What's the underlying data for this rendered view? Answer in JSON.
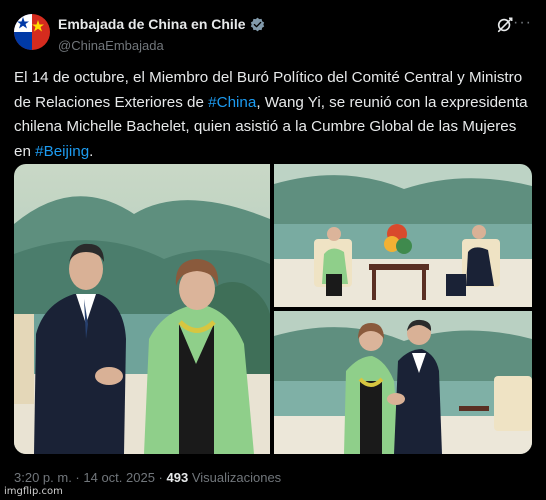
{
  "author": {
    "display_name": "Embajada de China en Chile",
    "handle": "@ChinaEmbajada"
  },
  "tweet": {
    "text_before_tag1": "El 14 de octubre, el Miembro del Buró Político del Comité Central y Ministro de Relaciones Exteriores de ",
    "hashtag1": "#China",
    "text_between": ", Wang Yi, se reunió con la expresidenta chilena Michelle Bachelet, quien asistió a la Cumbre Global de las Mujeres en ",
    "hashtag2": "#Beijing",
    "text_after": "."
  },
  "meta": {
    "time": "3:20 p. m.",
    "separator1": " · ",
    "date": "14 oct. 2025",
    "separator2": " · ",
    "views_count": "493",
    "views_label": " Visualizaciones"
  },
  "watermark": "imgflip.com",
  "colors": {
    "background": "#000000",
    "text": "#e7e9ea",
    "muted": "#71767b",
    "link": "#1d9bf0",
    "verified": "#829aab"
  },
  "icons": {
    "verified": "verified-badge-icon",
    "grok": "grok-icon",
    "more": "more-options-icon"
  }
}
